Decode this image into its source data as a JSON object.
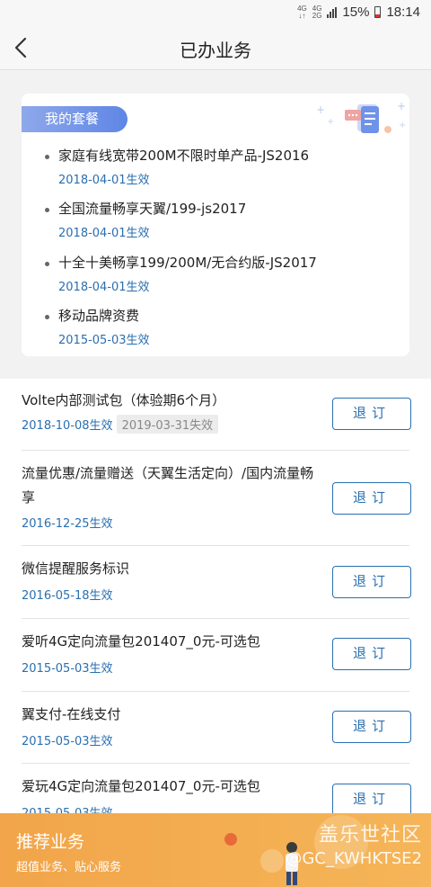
{
  "status_bar": {
    "net1_top": "4G",
    "net1_bottom": "↓↑",
    "net2_top": "4G",
    "net2_bottom": "2G",
    "battery": "15%",
    "time": "18:14"
  },
  "nav": {
    "title": "已办业务"
  },
  "my_plan": {
    "tag": "我的套餐",
    "items": [
      {
        "name": "家庭有线宽带200M不限时单产品-JS2016",
        "date": "2018-04-01生效"
      },
      {
        "name": "全国流量畅享天翼/199-js2017",
        "date": "2018-04-01生效"
      },
      {
        "name": "十全十美畅享199/200M/无合约版-JS2017",
        "date": "2018-04-01生效"
      },
      {
        "name": "移动品牌资费",
        "date": "2015-05-03生效"
      }
    ]
  },
  "services": [
    {
      "name": "Volte内部测试包（体验期6个月）",
      "date": "2018-10-08生效",
      "expire": "2019-03-31失效"
    },
    {
      "name": "流量优惠/流量赠送（天翼生活定向）/国内流量畅享",
      "date": "2016-12-25生效"
    },
    {
      "name": "微信提醒服务标识",
      "date": "2016-05-18生效"
    },
    {
      "name": "爱听4G定向流量包201407_0元-可选包",
      "date": "2015-05-03生效"
    },
    {
      "name": "翼支付-在线支付",
      "date": "2015-05-03生效"
    },
    {
      "name": "爱玩4G定向流量包201407_0元-可选包",
      "date": "2015-05-03生效"
    }
  ],
  "unsubscribe_label": "退订",
  "banner": {
    "title": "推荐业务",
    "subtitle": "超值业务、贴心服务",
    "watermark_1": "盖乐世社区",
    "watermark_2": "@GC_KWHKTSE2"
  },
  "colors": {
    "accent": "#2a6fb0",
    "banner": "#f2a54a",
    "tag": "#6f93e8"
  }
}
